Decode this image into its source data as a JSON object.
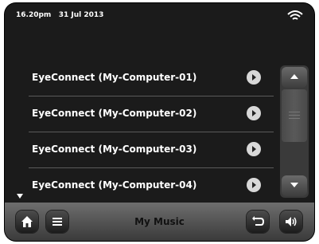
{
  "status": {
    "time": "16.20pm",
    "date": "31 Jul 2013",
    "wifi_icon": "wifi-icon"
  },
  "list": {
    "items": [
      {
        "label": "EyeConnect (My-Computer-01)"
      },
      {
        "label": "EyeConnect (My-Computer-02)"
      },
      {
        "label": "EyeConnect (My-Computer-03)"
      },
      {
        "label": "EyeConnect (My-Computer-04)"
      }
    ]
  },
  "bottom": {
    "title": "My Music",
    "home_icon": "home-icon",
    "menu_icon": "menu-icon",
    "back_icon": "back-icon",
    "volume_icon": "volume-icon"
  }
}
